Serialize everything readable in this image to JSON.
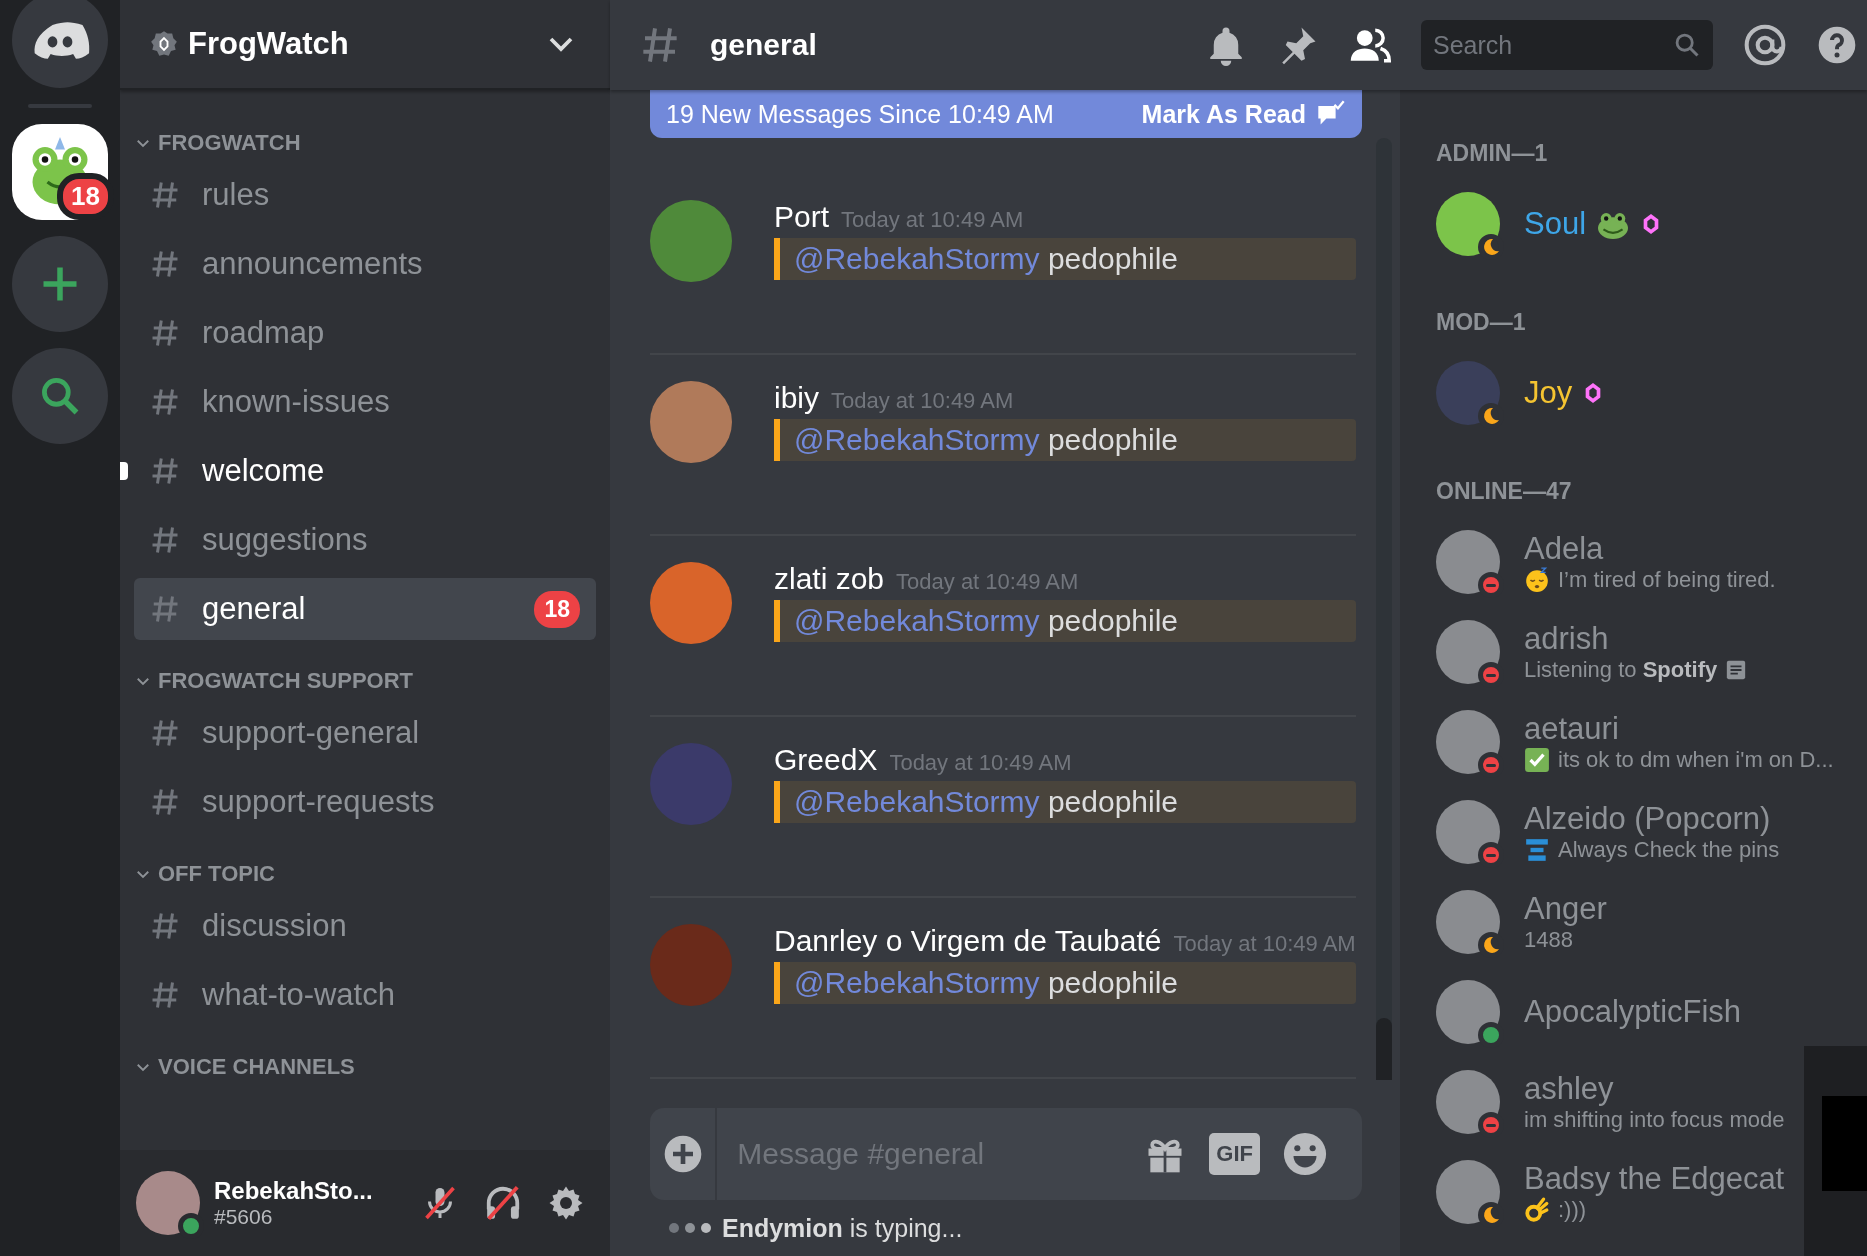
{
  "guild_rail": {
    "servers": [
      {
        "badge": "18",
        "selected": true
      }
    ]
  },
  "server": {
    "name": "FrogWatch"
  },
  "categories": [
    {
      "name": "FROGWATCH",
      "expanded": true,
      "channels": [
        {
          "name": "rules",
          "unread": false,
          "selected": false
        },
        {
          "name": "announcements",
          "unread": false,
          "selected": false
        },
        {
          "name": "roadmap",
          "unread": false,
          "selected": false
        },
        {
          "name": "known-issues",
          "unread": false,
          "selected": false
        },
        {
          "name": "welcome",
          "unread": true,
          "selected": false
        },
        {
          "name": "suggestions",
          "unread": false,
          "selected": false
        },
        {
          "name": "general",
          "unread": false,
          "selected": true,
          "badge": "18"
        }
      ]
    },
    {
      "name": "FROGWATCH SUPPORT",
      "expanded": true,
      "channels": [
        {
          "name": "support-general",
          "unread": false,
          "selected": false
        },
        {
          "name": "support-requests",
          "unread": false,
          "selected": false
        }
      ]
    },
    {
      "name": "OFF TOPIC",
      "expanded": true,
      "channels": [
        {
          "name": "discussion",
          "unread": false,
          "selected": false
        },
        {
          "name": "what-to-watch",
          "unread": false,
          "selected": false
        }
      ]
    },
    {
      "name": "VOICE CHANNELS",
      "expanded": true
    }
  ],
  "user_panel": {
    "name": "RebekahSto...",
    "tag": "#5606",
    "status": {
      "kind": "online",
      "color": "#3ba55d"
    },
    "muted": true,
    "deafened": true
  },
  "header": {
    "channel": "general",
    "search_placeholder": "Search"
  },
  "new_messages_bar": {
    "text": "19 New Messages Since 10:49 AM",
    "action": "Mark As Read"
  },
  "messages": [
    {
      "author": "Port",
      "timestamp": "Today at 10:49 AM",
      "mention": "@RebekahStormy",
      "text": "pedophile",
      "highlighted": true
    },
    {
      "author": "ibiy",
      "timestamp": "Today at 10:49 AM",
      "mention": "@RebekahStormy",
      "text": "pedophile",
      "highlighted": true
    },
    {
      "author": "zlati zob",
      "timestamp": "Today at 10:49 AM",
      "mention": "@RebekahStormy",
      "text": "pedophile",
      "highlighted": true
    },
    {
      "author": "GreedX",
      "timestamp": "Today at 10:49 AM",
      "mention": "@RebekahStormy",
      "text": "pedophile",
      "highlighted": true
    },
    {
      "author": "Danrley o Virgem de Taubaté",
      "timestamp": "Today at 10:49 AM",
      "mention": "@RebekahStormy",
      "text": "pedophile",
      "highlighted": true
    }
  ],
  "composer": {
    "placeholder": "Message #general",
    "gif_label": "GIF"
  },
  "typing": "**Endymion** is typing...",
  "member_groups": [
    {
      "title": "ADMIN—1",
      "members": [
        {
          "name": "Soul",
          "color": "#3ea6e8",
          "status": {
            "kind": "idle",
            "color": "#faa61a"
          },
          "name_emoji": true,
          "boosting": true
        }
      ]
    },
    {
      "title": "MOD—1",
      "members": [
        {
          "name": "Joy",
          "color": "#f5c431",
          "status": {
            "kind": "idle",
            "color": "#faa61a"
          },
          "boosting": true
        }
      ]
    },
    {
      "title": "ONLINE—47",
      "members": [
        {
          "name": "Adela",
          "color": "#8e9297",
          "status": {
            "kind": "dnd",
            "color": "#ed4245"
          },
          "activity": {
            "text": "I’m tired of being tired.",
            "kind": "sleepy"
          }
        },
        {
          "name": "adrish",
          "color": "#8e9297",
          "status": {
            "kind": "dnd",
            "color": "#ed4245"
          },
          "activity": {
            "text": "Listening to **Spotify**",
            "kind": "listening"
          }
        },
        {
          "name": "aetauri",
          "color": "#8e9297",
          "status": {
            "kind": "dnd",
            "color": "#ed4245"
          },
          "activity": {
            "text": "its ok to dm when i'm on D...",
            "kind": "check"
          }
        },
        {
          "name": "Alzeido (Popcorn)",
          "color": "#8e9297",
          "status": {
            "kind": "dnd",
            "color": "#ed4245"
          },
          "activity": {
            "text": "Always Check the pins",
            "kind": "pins"
          }
        },
        {
          "name": "Anger",
          "color": "#8e9297",
          "status": {
            "kind": "idle",
            "color": "#faa61a"
          },
          "activity": {
            "text": "1488",
            "kind": "plain"
          }
        },
        {
          "name": "ApocalypticFish",
          "color": "#8e9297",
          "status": {
            "kind": "online",
            "color": "#3ba55d"
          }
        },
        {
          "name": "ashley",
          "color": "#8e9297",
          "status": {
            "kind": "dnd",
            "color": "#ed4245"
          },
          "activity": {
            "text": "im shifting into focus mode",
            "kind": "plain"
          }
        },
        {
          "name": "Badsy the Edgecat",
          "color": "#8e9297",
          "status": {
            "kind": "idle",
            "color": "#faa61a"
          },
          "activity": {
            "text": ":)))",
            "kind": "ok"
          }
        }
      ]
    }
  ]
}
